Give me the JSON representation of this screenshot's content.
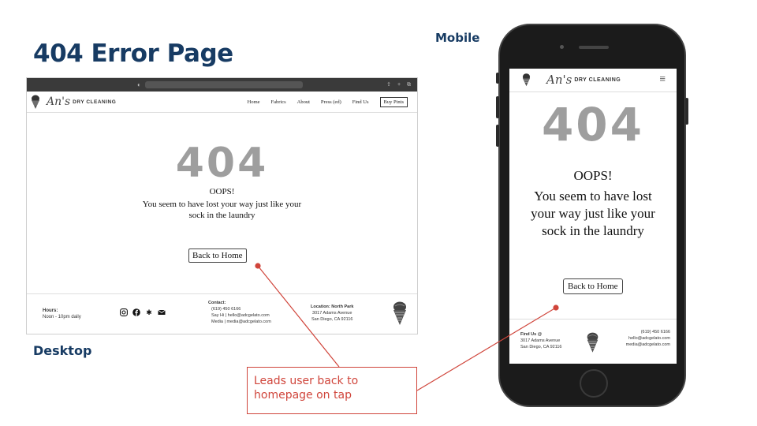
{
  "slide": {
    "title": "404 Error Page",
    "label_desktop": "Desktop",
    "label_mobile": "Mobile"
  },
  "desktop": {
    "browser": {
      "lock_icon": "lock-icon",
      "controls": "⇪ + ⧉"
    },
    "nav": {
      "script": "An's",
      "brand": "DRY CLEANING",
      "items": [
        "Home",
        "Fabrics",
        "About",
        "Press (ed)",
        "Find Us"
      ],
      "buy_button": "Buy Pints"
    },
    "error": {
      "code": "404",
      "heading": "OOPS!",
      "message": "You seem to have lost your way just like your sock in the laundry",
      "back_button": "Back to Home"
    },
    "footer": {
      "hours_title": "Hours:",
      "hours_value": "Noon - 10pm daily",
      "social_icons": [
        "instagram-icon",
        "facebook-icon",
        "yelp-icon",
        "email-icon"
      ],
      "contact_title": "Contact:",
      "contact_phone": "(619) 450 6166",
      "contact_hello": "Say Hi | hello@adcgelato.com",
      "contact_media": "Media | media@adcgelato.com",
      "location_title": "Location: North Park",
      "location_street": "3017 Adams Avenue",
      "location_city": "San Diego, CA 92116"
    }
  },
  "mobile": {
    "nav": {
      "script": "An's",
      "brand": "DRY CLEANING",
      "menu_icon": "≡"
    },
    "error": {
      "code": "404",
      "heading": "OOPS!",
      "message": "You seem to have lost your way just like your sock in the laundry",
      "back_button": "Back to Home"
    },
    "footer": {
      "find_title": "Find Us @",
      "find_street": "3017 Adams Avenue",
      "find_city": "San Diego, CA 92116",
      "phone": "(619) 450 6166",
      "hello": "hello@adcgelato.com",
      "media": "media@adcgelato.com"
    }
  },
  "annotation": {
    "text": "Leads user back to homepage on tap",
    "color": "#d0453b"
  },
  "colors": {
    "title": "#173b63",
    "error_code": "#9e9e9e",
    "annotation": "#d0453b"
  }
}
